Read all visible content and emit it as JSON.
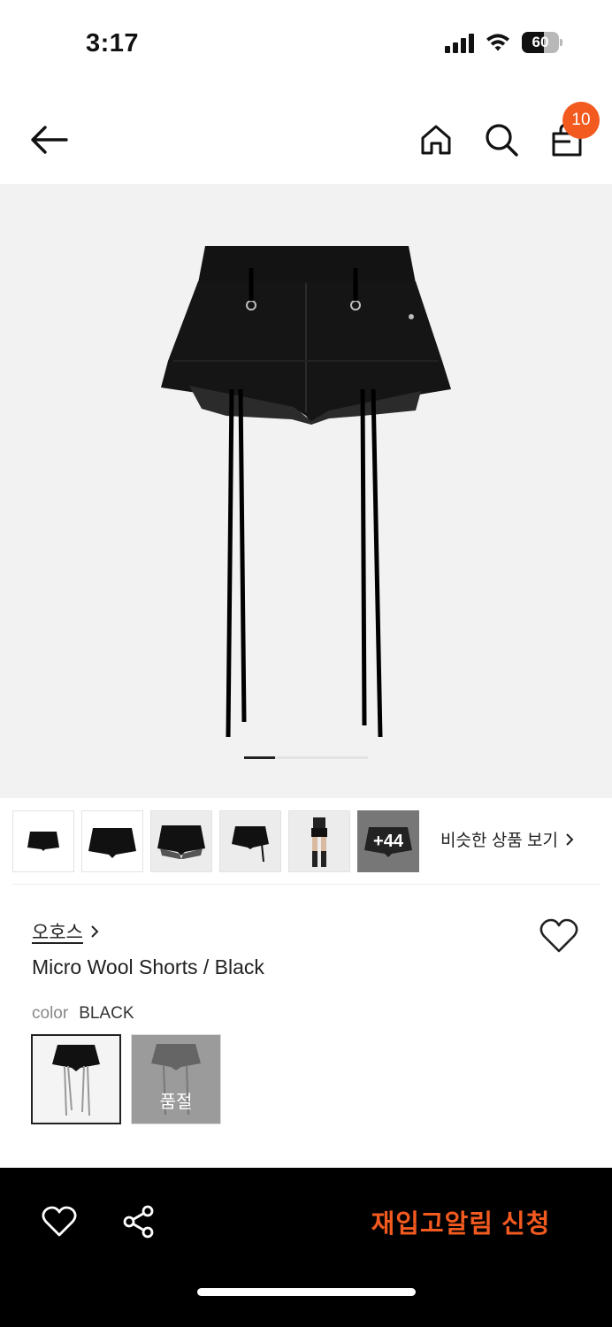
{
  "status_bar": {
    "time": "3:17",
    "battery": "60",
    "battery_level": 0.6
  },
  "nav": {
    "cart_count": "10"
  },
  "gallery": {
    "current_index": 1,
    "more_count_label": "+44",
    "similar_label": "비슷한 상품 보기"
  },
  "product": {
    "brand": "오호스",
    "name": "Micro Wool Shorts / Black",
    "color_label": "color",
    "color_value": "BLACK",
    "soldout_label": "품절"
  },
  "bottom_bar": {
    "restock_label": "재입고알림 신청"
  },
  "colors": {
    "accent": "#f25a1f",
    "bar_bg": "#000000",
    "hero_bg": "#f2f2f2"
  },
  "icons": [
    "back-arrow-icon",
    "home-icon",
    "search-icon",
    "shopping-bag-icon",
    "heart-icon",
    "share-icon",
    "chevron-right-icon"
  ]
}
